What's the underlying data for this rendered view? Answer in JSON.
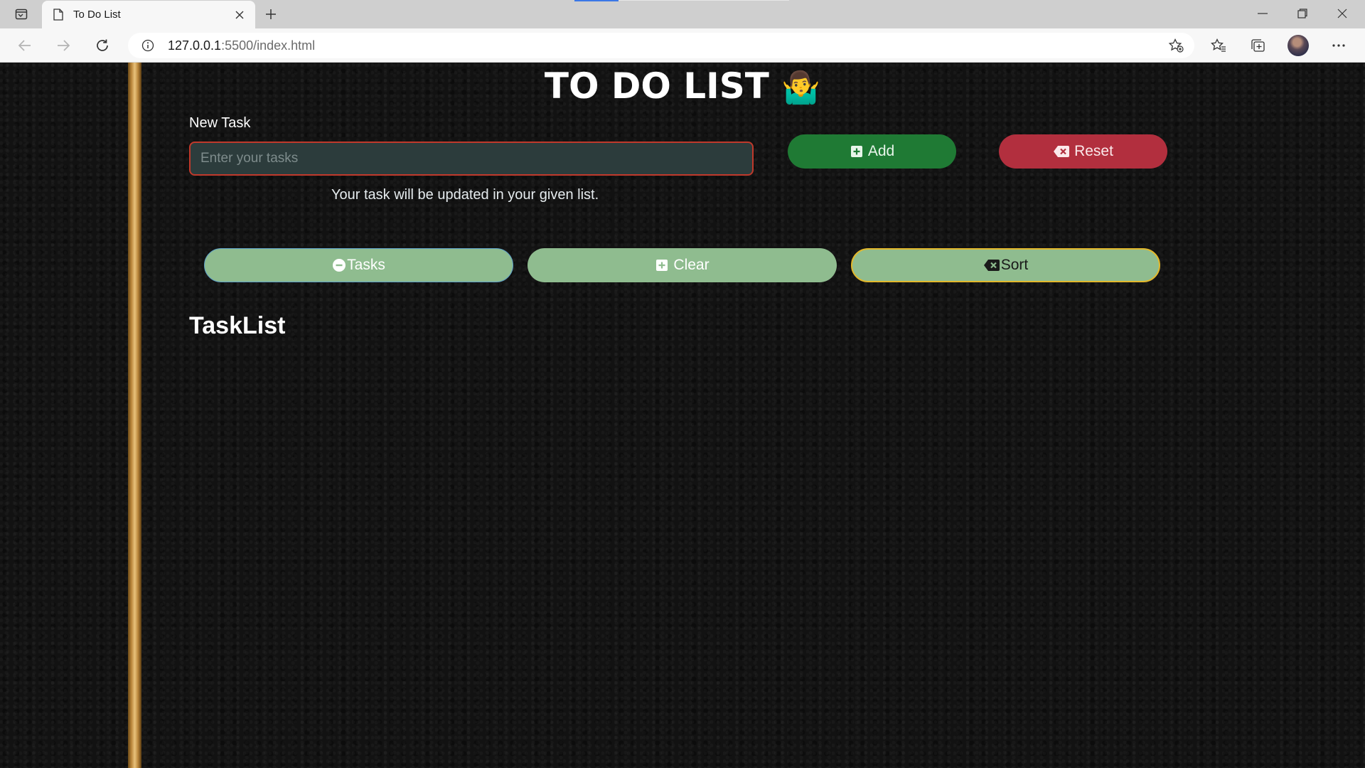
{
  "browser": {
    "tab": {
      "title": "To Do List"
    },
    "address": {
      "host": "127.0.0.1",
      "rest": ":5500/index.html"
    },
    "icons": [
      "tab-actions-icon",
      "page-icon",
      "close-icon",
      "plus-icon",
      "minimize-icon",
      "restore-icon",
      "close-window-icon",
      "back-icon",
      "forward-icon",
      "refresh-icon",
      "info-icon",
      "add-favorite-icon",
      "favorites-icon",
      "collections-icon",
      "more-icon"
    ]
  },
  "page": {
    "title": "TO DO LIST",
    "title_emoji": "🤷‍♂️",
    "new_task_label": "New Task",
    "input_placeholder": "Enter your tasks",
    "input_value": "",
    "hint": "Your task will be updated in your given list.",
    "buttons": {
      "add": "Add",
      "reset": "Reset",
      "tasks": "Tasks",
      "clear": "Clear",
      "sort": "Sort"
    },
    "tasklist_heading": "TaskList",
    "colors": {
      "add": "#1f7a34",
      "reset": "#b22f3e",
      "action_buttons": "#8fbc8f",
      "input_border": "#c0392b",
      "sort_border": "#e2b82c"
    }
  }
}
